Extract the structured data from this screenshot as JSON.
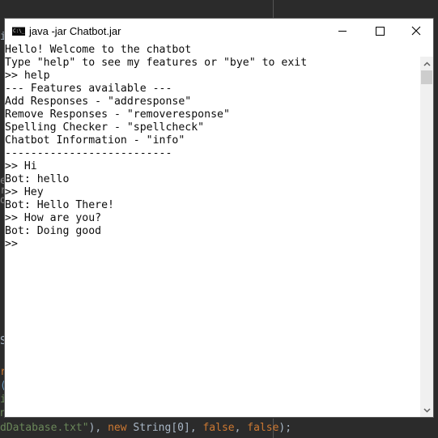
{
  "window": {
    "title": "java  -jar Chatbot.jar",
    "icon": "console-icon",
    "icon_text": "C:\\_",
    "controls": {
      "minimize": "minimize-icon",
      "maximize": "maximize-icon",
      "close": "close-icon"
    }
  },
  "console": {
    "lines": [
      "Hello! Welcome to the chatbot",
      "Type \"help\" to see my features or \"bye\" to exit",
      ">> help",
      "--- Features available ---",
      "Add Responses - \"addresponse\"",
      "Remove Responses - \"removeresponse\"",
      "Spelling Checker - \"spellcheck\"",
      "Chatbot Information - \"info\"",
      "--------------------------",
      ">> Hi",
      "Bot: hello",
      ">> Hey",
      "Bot: Hello There!",
      ">> How are you?",
      "Bot: Doing good",
      ">>"
    ]
  },
  "scrollbar": {
    "up": "^",
    "down": "v",
    "position": 0
  },
  "background_editor": {
    "gutter_chars": [
      {
        "text": "i",
        "color": "#a9b7c6"
      },
      {
        "text": "e",
        "color": "#808080"
      },
      {
        "text": "r",
        "color": "#808080"
      },
      {
        "text": "d",
        "color": "#808080"
      },
      {
        "text": "S",
        "color": "#a9b7c6"
      },
      {
        "text": "r",
        "color": "#cc7832"
      },
      {
        "text": "(",
        "color": "#6897bb"
      },
      {
        "text": "i",
        "color": "#6a8759"
      },
      {
        "text": "n",
        "color": "#6a8759"
      }
    ],
    "code_line": {
      "part1": "dDatabase.txt\"",
      "part2": "), ",
      "part3": "new",
      "part4": " String[0], ",
      "part5": "false",
      "part6": ", ",
      "part7": "false",
      "part8": ");"
    }
  },
  "colors": {
    "editor_bg": "#2b2b2b",
    "console_bg": "#ffffff",
    "console_text": "#0c0c0c",
    "string": "#6a8759",
    "keyword": "#cc7832",
    "plain": "#a9b7c6"
  }
}
